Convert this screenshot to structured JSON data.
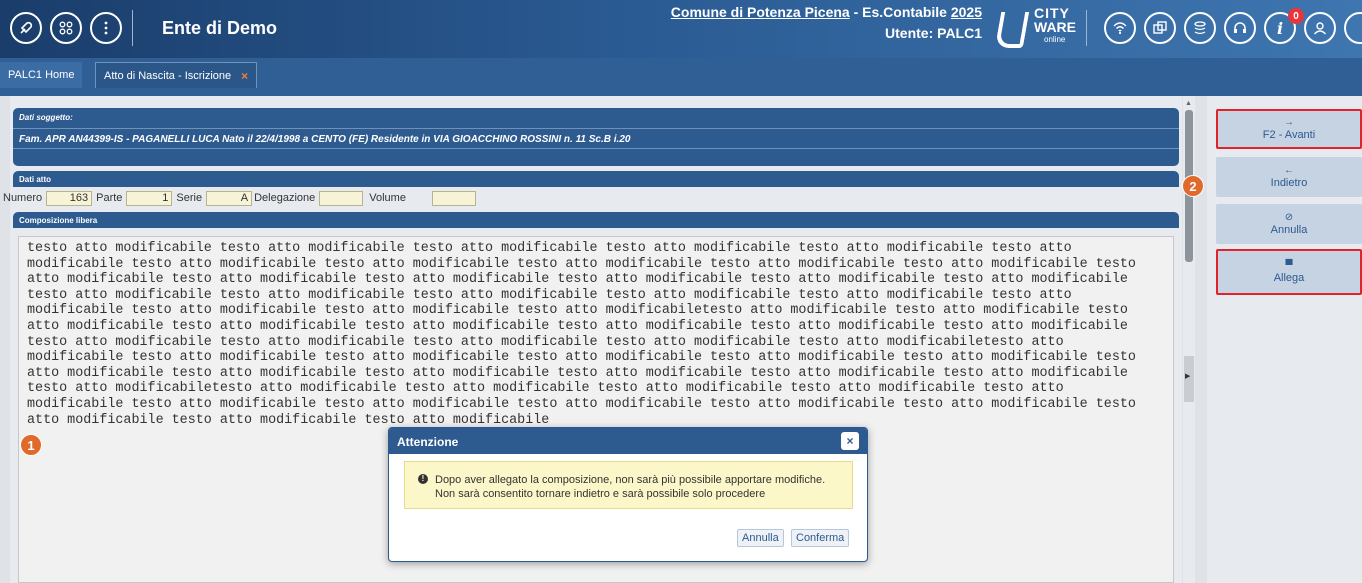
{
  "app": {
    "ente": "Ente di Demo",
    "comune_prefix": "Comune di Potenza Picena",
    "comune_mid": " - Es.Contabile ",
    "year": "2025",
    "utente": "Utente: PALC1",
    "logo_line1": "CITY",
    "logo_line2": "WARE",
    "logo_line3": "online",
    "notification_count": "0"
  },
  "top_icons": [
    "rocket-icon",
    "grid-icon",
    "info-menu-icon",
    "wifi-icon",
    "window-icon",
    "stack-icon",
    "headset-icon",
    "info-icon",
    "user-icon",
    "more-icon"
  ],
  "tabs": [
    {
      "label": "PALC1 Home"
    },
    {
      "label": "Atto di Nascita - Iscrizione",
      "close": "×"
    }
  ],
  "subject": {
    "label": "Dati soggetto:",
    "text": "Fam. APR AN44399-IS - PAGANELLI LUCA Nato il 22/4/1998 a CENTO (FE) Residente in VIA GIOACCHINO ROSSINI n. 11 Sc.B i.20"
  },
  "atto": {
    "header": "Dati atto",
    "numero_label": "Numero",
    "numero": "163",
    "parte_label": "Parte",
    "parte": "1",
    "serie_label": "Serie",
    "serie": "A",
    "delegazione_label": "Delegazione",
    "delegazione": "",
    "volume_label": "Volume",
    "volume": ""
  },
  "composizione": {
    "header": "Composizione libera",
    "lines": [
      "testo atto modificabile testo atto modificabile testo atto modificabile testo atto modificabile testo atto modificabile testo atto",
      "modificabile testo atto modificabile testo atto modificabile testo atto modificabile testo atto modificabile testo atto modificabile testo",
      "atto modificabile testo atto modificabile testo atto modificabile testo atto modificabile testo atto modificabile testo atto modificabile",
      "testo atto modificabile testo atto modificabile testo atto modificabile testo atto modificabile testo atto modificabile testo atto",
      "modificabile testo atto modificabile testo atto modificabile testo atto modificabiletesto atto modificabile testo atto modificabile testo",
      "atto modificabile testo atto modificabile testo atto modificabile testo atto modificabile testo atto modificabile testo atto modificabile",
      "testo atto modificabile testo atto modificabile testo atto modificabile testo atto modificabile testo atto modificabiletesto atto",
      "modificabile testo atto modificabile testo atto modificabile testo atto modificabile testo atto modificabile testo atto modificabile testo",
      "atto modificabile testo atto modificabile testo atto modificabile testo atto modificabile testo atto modificabile testo atto modificabile",
      "testo atto modificabiletesto atto modificabile testo atto modificabile testo atto modificabile testo atto modificabile testo atto",
      "modificabile testo atto modificabile testo atto modificabile testo atto modificabile testo atto modificabile testo atto modificabile testo",
      "atto modificabile testo atto modificabile testo atto modificabile"
    ]
  },
  "badges": {
    "one": "1",
    "two": "2"
  },
  "actions": [
    {
      "icon": "→",
      "label": "F2 - Avanti"
    },
    {
      "icon": "←",
      "label": "Indietro"
    },
    {
      "icon": "⊘",
      "label": "Annulla"
    },
    {
      "icon": "▀",
      "label": "Allega"
    }
  ],
  "dialog": {
    "title": "Attenzione",
    "close": "×",
    "warning_icon": "!",
    "message_line1": "Dopo aver allegato la composizione, non sarà più possibile apportare modifiche.",
    "message_line2": "Non sarà consentito tornare indietro e sarà possibile solo procedere",
    "cancel": "Annulla",
    "confirm": "Conferma"
  },
  "colors": {
    "header": "#2d5a8f",
    "highlight": "#e0232b",
    "badge": "#e06a2c",
    "warning_bg": "#fcf7c9",
    "field_bg": "#f7f3d6"
  }
}
